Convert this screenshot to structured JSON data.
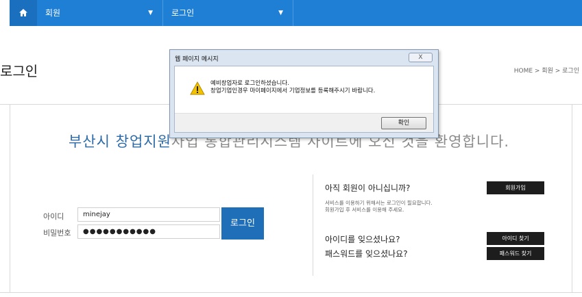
{
  "nav": {
    "home_icon": "home-icon",
    "menu1": "회원",
    "menu2": "로그인",
    "caret": "▼"
  },
  "page": {
    "title": "로그인",
    "breadcrumb": "HOME > 회원 > 로그인"
  },
  "welcome": {
    "visible": "부산시 창업지원",
    "obscured": "사업 통합관리시스템 사이트에 오신 것을",
    "tail": "환영합니다."
  },
  "login": {
    "id_label": "아이디",
    "id_value": "minejay",
    "pw_label": "비밀번호",
    "pw_value": "●●●●●●●●●●●",
    "login_button": "로그인"
  },
  "side": {
    "not_member": "아직 회원이 아니십니까?",
    "signup_button": "회원가입",
    "note_line1": "서비스를 이용하기 위해서는 로그인이 필요합니다.",
    "note_line2": "회원가입 후 서비스를 이용해 주세요.",
    "forgot_id": "아이디를 잊으셨나요?",
    "find_id_button": "아이디 찾기",
    "forgot_pw": "패스워드를 잊으셨나요?",
    "find_pw_button": "패스워드 찾기"
  },
  "dialog": {
    "title": "웹 페이지 메시지",
    "close": "X",
    "line1": "예비창업자로 로그인하셨습니다.",
    "line2": "창업기업인경우 마이페이지에서 기업정보를 등록해주시기 바랍니다.",
    "ok": "확인",
    "warning_icon": "warning-icon"
  }
}
